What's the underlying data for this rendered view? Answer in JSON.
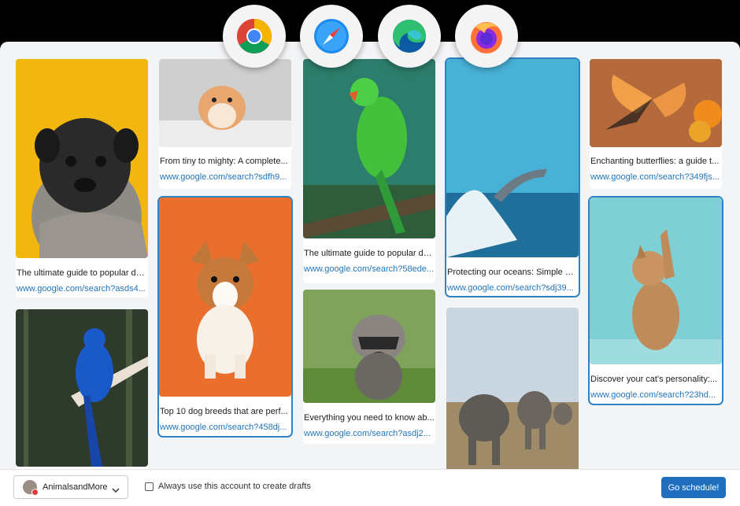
{
  "browsers": [
    {
      "name": "chrome-icon"
    },
    {
      "name": "safari-icon"
    },
    {
      "name": "edge-icon"
    },
    {
      "name": "firefox-icon"
    }
  ],
  "cards": [
    {
      "title": "The ultimate guide to popular do...",
      "link": "www.google.com/search?asds4...",
      "image": "pug"
    },
    {
      "title": "",
      "link": "",
      "image": "blue-macaw"
    },
    {
      "title": "From tiny to mighty: A complete...",
      "link": "www.google.com/search?sdfh9...",
      "image": "hamster"
    },
    {
      "title": "Top 10 dog breeds that are perf...",
      "link": "www.google.com/search?458dj...",
      "image": "corgi-puppy",
      "selected": true
    },
    {
      "title": "The ultimate guide to popular do...",
      "link": "www.google.com/search?58ede...",
      "image": "green-parrot"
    },
    {
      "title": "Everything you need to know ab...",
      "link": "www.google.com/search?asdj2...",
      "image": "raccoon"
    },
    {
      "title": "Protecting our oceans: Simple w...",
      "link": "www.google.com/search?sdj39...",
      "image": "dolphin",
      "selected": true
    },
    {
      "title": "",
      "link": "",
      "image": "elephants"
    },
    {
      "title": "Enchanting butterflies: a guide t...",
      "link": "www.google.com/search?349fjs...",
      "image": "butterfly"
    },
    {
      "title": "Discover your cat's personality:...",
      "link": "www.google.com/search?23hd...",
      "image": "kitten",
      "selected": true
    }
  ],
  "footer": {
    "account_name": "AnimalsandMore",
    "checkbox_label": "Always use this account to create drafts",
    "checkbox_checked": false,
    "button_label": "Go schedule!"
  },
  "colors": {
    "accent": "#1f6fbe",
    "link": "#2275b9",
    "selection": "#2f82c6"
  }
}
